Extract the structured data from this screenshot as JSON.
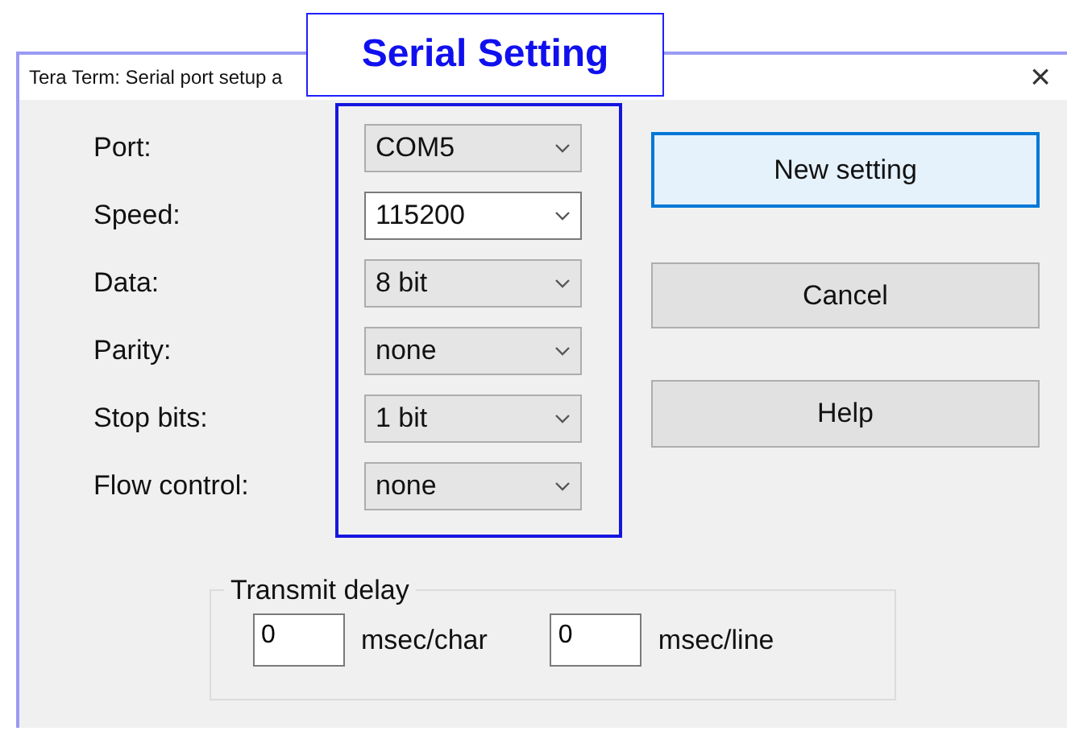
{
  "callout": {
    "text": "Serial Setting"
  },
  "window": {
    "title": "Tera Term: Serial port setup a",
    "close": "×"
  },
  "settings": [
    {
      "label": "Port:",
      "value": "COM5",
      "kind": "dropdown"
    },
    {
      "label": "Speed:",
      "value": "115200",
      "kind": "editable"
    },
    {
      "label": "Data:",
      "value": "8 bit",
      "kind": "dropdown"
    },
    {
      "label": "Parity:",
      "value": "none",
      "kind": "dropdown"
    },
    {
      "label": "Stop bits:",
      "value": "1 bit",
      "kind": "dropdown"
    },
    {
      "label": "Flow control:",
      "value": "none",
      "kind": "dropdown"
    }
  ],
  "buttons": [
    {
      "label": "New setting",
      "focused": true
    },
    {
      "label": "Cancel",
      "focused": false
    },
    {
      "label": "Help",
      "focused": false
    }
  ],
  "transmit_delay": {
    "title": "Transmit delay",
    "fields": [
      {
        "value": "0",
        "unit": "msec/char"
      },
      {
        "value": "0",
        "unit": "msec/line"
      }
    ]
  }
}
